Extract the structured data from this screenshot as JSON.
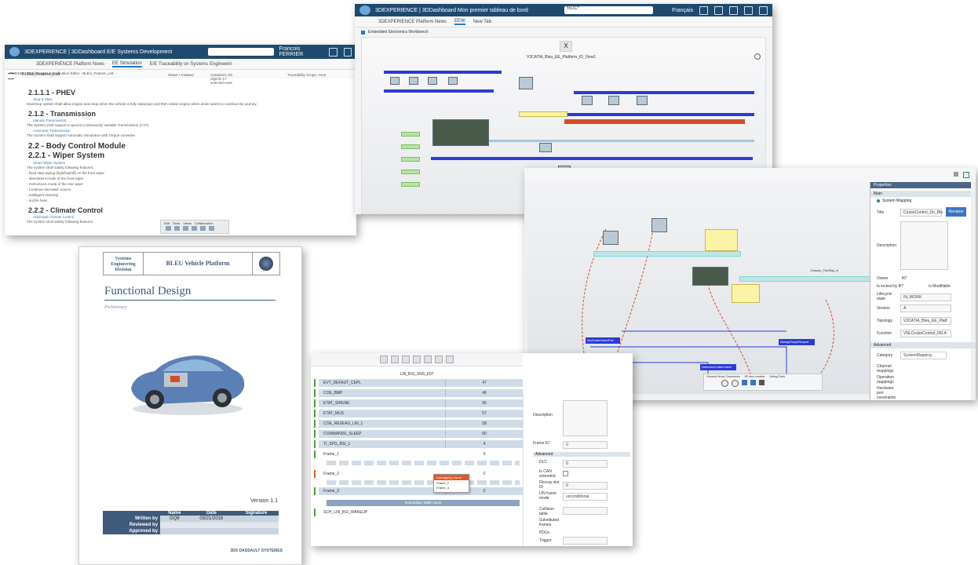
{
  "colors": {
    "brand": "#1f4a70",
    "accent": "#1f7ad0",
    "bus_blue": "#2b3bd6",
    "bus_red": "#d44b2a",
    "bus_teal": "#7fd6d6",
    "note_yellow": "#fbf3a6",
    "doc_title": "#3f5a7a"
  },
  "w1": {
    "title": "3DEXPERIENCE | 3DDashboard E/E Systems Development",
    "user": "Francois FERRIER",
    "tabs": [
      "3DEXPERIENCE Platform News",
      "EE Simulation",
      "E/E Traceability on Systems Engineerin"
    ],
    "breadcrumb": "PMD168 · Requirements Specification Editor · BLEU_Feature_List",
    "doc_name": "BLEU_Feature_List",
    "status": "Status • Initiated",
    "containers": "containers 3/2",
    "objects": "objects 17",
    "selected": "selected none",
    "traceability": "Traceability Scope: none",
    "sections": [
      {
        "title": "2.1.1.1 - PHEV",
        "level": "h3",
        "req": "Stop & Start",
        "lines": [
          "Start/stop system shall allow engine auto-stop when the vehicle is fully stationary and then restart engine when driver wants to continue the journey."
        ]
      },
      {
        "title": "2.1.2 - Transmission",
        "level": "h3",
        "req": "Manual Transmission",
        "lines": [
          "The System shall support a special Continuously Variable Transmission (CVT)"
        ]
      },
      {
        "title": "",
        "level": "",
        "req": "Automatic Transmission",
        "lines": [
          "The System shall support Automatic Simulation with Torque converter"
        ]
      },
      {
        "title": "2.2 - Body Control Module",
        "level": "h2",
        "req": "",
        "lines": []
      },
      {
        "title": "2.2.1 - Wiper System",
        "level": "h2",
        "req": "Smart Wiper System",
        "lines": [
          "The system shall satisfy following features:",
          "- fixed step wiping (high/low/off) on the front wiper",
          "- intermittent mode of the front wiper",
          "- Instructions mode of the rear wiper",
          "- Continue-and-wash source",
          "- Intelligent cleaning",
          "- nozzle heat"
        ]
      },
      {
        "title": "2.2.2 - Climate Control",
        "level": "h3",
        "req": "Automatic Climate Control",
        "lines": [
          "The system shall satisfy following features"
        ]
      }
    ],
    "toolbar_tabs": [
      "Edit",
      "Tools",
      "Views",
      "Collaboration"
    ]
  },
  "w2": {
    "title": "3DEXPERIENCE | 3DDashboard Mon premier tableau de bord",
    "search": "%UC*",
    "lang": "Français",
    "tabs": [
      "3DEXPERIENCE Platform News",
      "EEW",
      "New Tab"
    ],
    "panel": "Embedded Electronics Workbench",
    "view": "V2CATIA_Bleu_EE_Platform_ID_View1"
  },
  "w3": {
    "org": "Systems Engineering Division",
    "platform": "BLEU Vehicle Platform",
    "title": "Functional Design",
    "subtitle": "Preliminary",
    "version": "Version 1.1",
    "table_headers": [
      "",
      "Name",
      "Date",
      "Signature"
    ],
    "table_rows": [
      [
        "Written by",
        "GQ8",
        "03/21/2016",
        ""
      ],
      [
        "Reviewed by",
        "",
        "",
        ""
      ],
      [
        "Approved by",
        "",
        "",
        ""
      ]
    ],
    "footer": "3DS DASSAULT SYSTEMES"
  },
  "w4": {
    "panel_title": "Properties",
    "section_main": "Main",
    "item": "System Mapping",
    "title_label": "Title",
    "title_value": "CruiseControl_On_Ble",
    "rename": "Rename",
    "description_label": "Description",
    "owner_label": "Owner",
    "owner_value": "fil7",
    "locked_label": "Is locked by fil7",
    "modifiable": "Is Modifiable",
    "lifecycle_label": "Lifecycle state",
    "lifecycle_value": "IN_WORK",
    "version_label": "Version",
    "version_value": "A",
    "topology_label": "Topology",
    "topology_value": "V2CATIA_Bleu_EE_Platf",
    "function_label": "Function",
    "function_value": "VNLCruiseControl_NG A",
    "section_adv": "Advanced",
    "category_label": "Category",
    "category_value": "SystemMapping",
    "other_labels": [
      "Channel mappings",
      "Operation mappings",
      "Hardware port constraints"
    ],
    "bottom_tabs": [
      "General Server Commands",
      "EE Item creation",
      "Debug Tools"
    ],
    "diagram_labels": [
      "AccCruiseControlPrio",
      "AccSlowBraksLimitsFrom",
      "AccCruiseControlReq",
      "DetermineCruiseControl",
      "ManageTorqueRequest",
      "Chassis_FlexRay_A"
    ]
  },
  "w5": {
    "frame_title": "LIN_BSI_SNS_F07",
    "rows": [
      {
        "name": "EVT_DEFAUT_CEPL",
        "num": "47",
        "color": "#4f9e3c"
      },
      {
        "name": "COE_BMP",
        "num": "46",
        "color": "#4f9e3c"
      },
      {
        "name": "ETAT_SIRENE",
        "num": "56",
        "color": "#4f9e3c"
      },
      {
        "name": "ETAT_MUS",
        "num": "57",
        "color": "#4f9e3c"
      },
      {
        "name": "COE_RESEAU_LIN_1",
        "num": "58",
        "color": "#4f9e3c"
      },
      {
        "name": "COMMANDE_SLEEP",
        "num": "60",
        "color": "#4f9e3c"
      },
      {
        "name": "TI_SPG_BSI_1",
        "num": "4",
        "color": "#4f9e3c"
      },
      {
        "name": "Frame_1",
        "num": "0",
        "color": "#4f9e3c"
      },
      {
        "name": "Frame_2",
        "num": "0",
        "color": "#e3552b"
      },
      {
        "name": "Frame_3",
        "num": "0",
        "color": "#4f9e3c"
      }
    ],
    "popup_title": "Unmapping frame",
    "popup_items": [
      "Frame_2",
      "Frame_3"
    ],
    "sched_header": "Scheduling Table name",
    "last_row": "SCH_LIN_BSI_WAKEUP",
    "props": {
      "description": "Description",
      "frame_id": "Frame ID",
      "frame_id_value": "0",
      "advanced": "Advanced",
      "dlc": "DLC",
      "dlc_value": "0",
      "is_can": "Is CAN extended",
      "flexray": "Flexray slot ID",
      "flexray_value": "0",
      "lin_mode": "LIN frame mode",
      "lin_mode_value": "unconditional",
      "collision": "Collision table",
      "substituted": "Substituted frames",
      "pdus": "PDUs",
      "trigger": "Trigger"
    }
  }
}
